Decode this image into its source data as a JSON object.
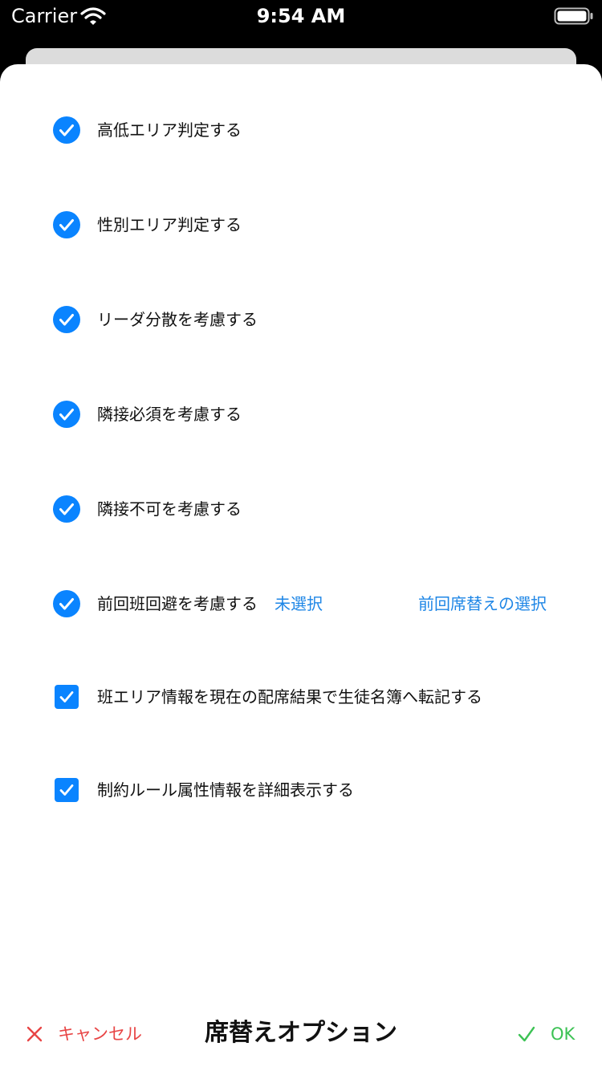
{
  "status_bar": {
    "carrier": "Carrier",
    "time": "9:54 AM"
  },
  "options": [
    {
      "label": "高低エリア判定する",
      "checked": true,
      "style": "circle"
    },
    {
      "label": "性別エリア判定する",
      "checked": true,
      "style": "circle"
    },
    {
      "label": "リーダ分散を考慮する",
      "checked": true,
      "style": "circle"
    },
    {
      "label": "隣接必須を考慮する",
      "checked": true,
      "style": "circle"
    },
    {
      "label": "隣接不可を考慮する",
      "checked": true,
      "style": "circle"
    },
    {
      "label": "前回班回避を考慮する",
      "checked": true,
      "style": "circle",
      "status": "未選択",
      "action": "前回席替えの選択"
    },
    {
      "label": "班エリア情報を現在の配席結果で生徒名簿へ転記する",
      "checked": true,
      "style": "square"
    },
    {
      "label": "制約ルール属性情報を詳細表示する",
      "checked": true,
      "style": "square"
    }
  ],
  "toolbar": {
    "cancel_label": "キャンセル",
    "title": "席替えオプション",
    "ok_label": "OK"
  },
  "colors": {
    "accent": "#0a84ff",
    "link": "#1e86e6",
    "cancel": "#e84545",
    "ok": "#3cc254"
  }
}
